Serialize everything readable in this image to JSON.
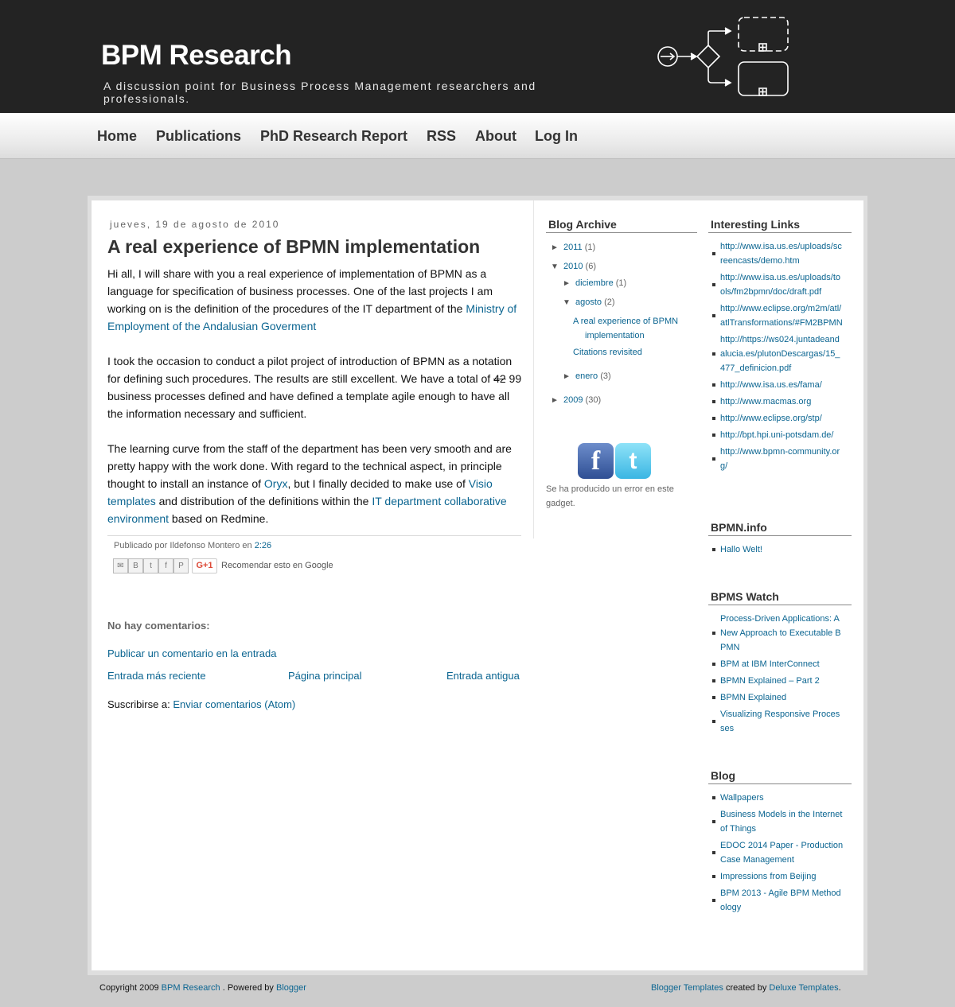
{
  "header": {
    "title": "BPM Research",
    "description": "A discussion point for Business Process Management researchers and professionals."
  },
  "nav": {
    "items": [
      "Home",
      "Publications",
      "PhD Research Report",
      "RSS",
      "About",
      "Log In"
    ]
  },
  "post": {
    "date": "jueves, 19 de agosto de 2010",
    "title": "A real experience of BPMN implementation",
    "p1_text": "Hi all, I will share with you a real experience of implementation of BPMN as a language for specification of business processes. One of the last projects I am working on is the definition of the procedures of the IT department of the ",
    "p1_link": "Ministry of Employment of the Andalusian Goverment",
    "p2_text_a": "I took the occasion to conduct a pilot project of introduction of BPMN as a notation for defining such procedures. The results are still excellent. We have a total of ",
    "p2_strike": "42",
    "p2_text_b": " 99 business processes defined and have defined a template agile enough to have all the information necessary and sufficient.",
    "p3_text_a": "The learning curve from the staff of the department has been very smooth and are pretty happy with the work done. With regard to the technical aspect, in principle thought to install an instance of ",
    "p3_link_oryx": "Oryx",
    "p3_text_b": ", but I finally decided to make use of ",
    "p3_link_visio": "Visio templates",
    "p3_text_c": " and distribution of the definitions within the ",
    "p3_link_it": "IT department collaborative environment",
    "p3_text_d": " based on Redmine.",
    "footer_by": "Publicado por Ildefonso Montero en ",
    "footer_time": "2:26",
    "share_icons": [
      "email-icon",
      "blogger-icon",
      "twitter-icon",
      "facebook-icon",
      "pinterest-icon"
    ],
    "gplus_label": "G+1",
    "share_text": "Recomendar esto en Google"
  },
  "comments": {
    "heading": "No hay comentarios:",
    "post_comment": "Publicar un comentario en la entrada",
    "newer": "Entrada más reciente",
    "home": "Página principal",
    "older": "Entrada antigua",
    "subscribe_label": "Suscribirse a: ",
    "subscribe_link": "Enviar comentarios (Atom)"
  },
  "archive": {
    "title": "Blog Archive",
    "y2011": {
      "label": "2011",
      "count": "(1)",
      "toggle": "►"
    },
    "y2010": {
      "label": "2010",
      "count": "(6)",
      "toggle": "▼"
    },
    "diciembre": {
      "label": "diciembre",
      "count": "(1)",
      "toggle": "►"
    },
    "agosto": {
      "label": "agosto",
      "count": "(2)",
      "toggle": "▼"
    },
    "post1": "A real experience of BPMN implementation",
    "post2": "Citations revisited",
    "enero": {
      "label": "enero",
      "count": "(3)",
      "toggle": "►"
    },
    "y2009": {
      "label": "2009",
      "count": "(30)",
      "toggle": "►"
    }
  },
  "gadget_error": "Se ha producido un error en este gadget.",
  "interesting_links": {
    "title": "Interesting Links",
    "items": [
      "http://www.isa.us.es/uploads/screencasts/demo.htm",
      "http://www.isa.us.es/uploads/tools/fm2bpmn/doc/draft.pdf",
      "http://www.eclipse.org/m2m/atl/atlTransformations/#FM2BPMN",
      "http://https://ws024.juntadeandalucia.es/plutonDescargas/15_477_definicion.pdf",
      "http://www.isa.us.es/fama/",
      "http://www.macmas.org",
      "http://www.eclipse.org/stp/",
      "http://bpt.hpi.uni-potsdam.de/",
      "http://www.bpmn-community.org/"
    ]
  },
  "bpmn_info": {
    "title": "BPMN.info",
    "items": [
      "Hallo Welt!"
    ]
  },
  "bpms_watch": {
    "title": "BPMS Watch",
    "items": [
      "Process-Driven Applications: A New Approach to Executable BPMN",
      "BPM at IBM InterConnect",
      "BPMN Explained – Part 2",
      "BPMN Explained",
      "Visualizing Responsive Processes"
    ]
  },
  "blog": {
    "title": "Blog",
    "items": [
      "Wallpapers",
      "Business Models in the Internet of Things",
      "EDOC 2014 Paper - Production Case Management",
      "Impressions from Beijing",
      "BPM 2013 - Agile BPM Methodology"
    ]
  },
  "footer": {
    "copyright": "Copyright 2009 ",
    "site_link": "BPM Research",
    "powered": " . Powered by ",
    "blogger_link": "Blogger",
    "templates_link": "Blogger Templates",
    "created_by": " created by ",
    "deluxe_link": "Deluxe Templates",
    "period": "."
  }
}
